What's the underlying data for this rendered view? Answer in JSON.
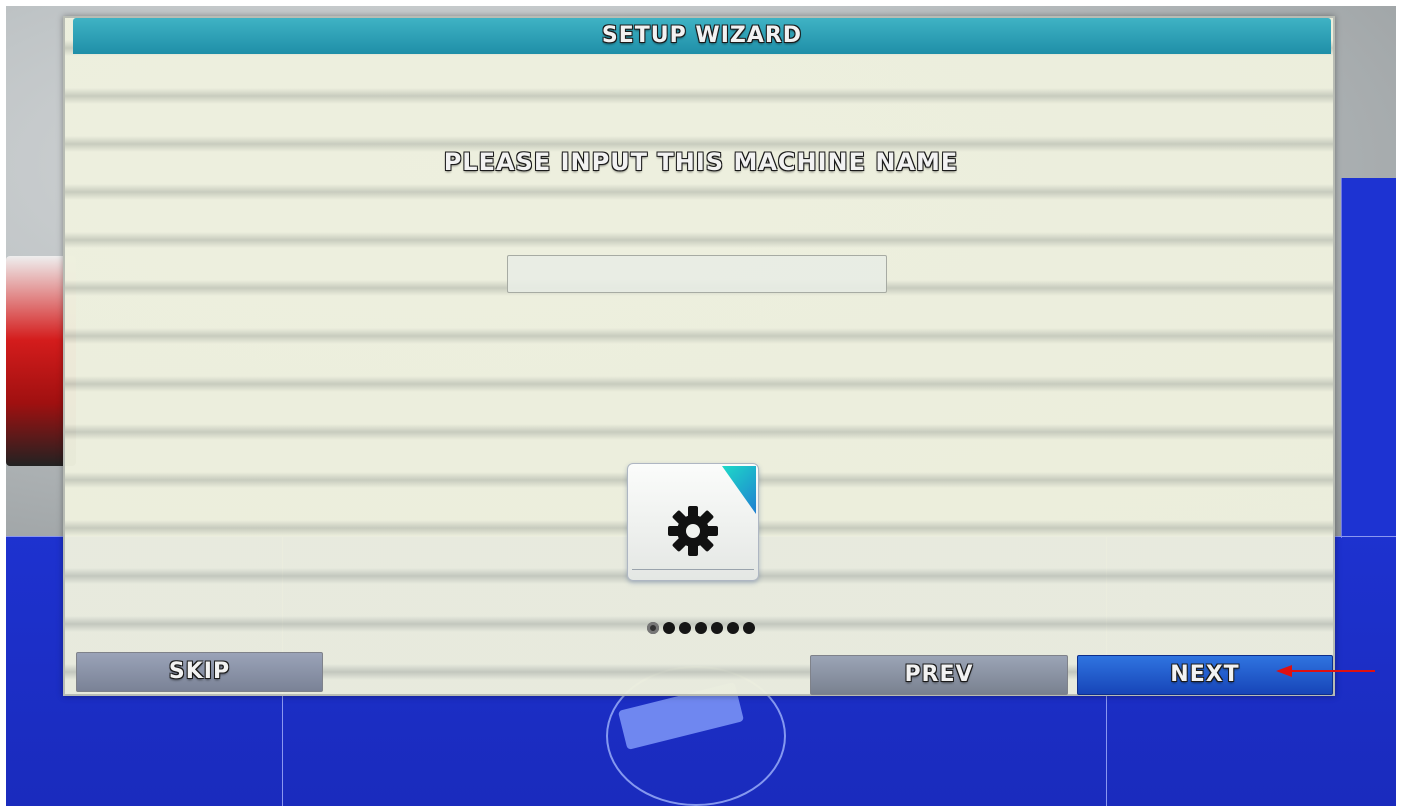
{
  "dialog": {
    "title": "SETUP WIZARD",
    "prompt": "PLEASE INPUT THIS MACHINE NAME",
    "machine_name_value": "",
    "wizard_step": 1,
    "wizard_total_steps": 7,
    "icon": "gear-icon"
  },
  "buttons": {
    "skip": "SKIP",
    "prev": "PREV",
    "next": "NEXT"
  },
  "colors": {
    "titlebar": "#1f8fa8",
    "next_button": "#2f74e0",
    "background_grid": "#1f35d8",
    "annotation_arrow": "#e01010"
  }
}
